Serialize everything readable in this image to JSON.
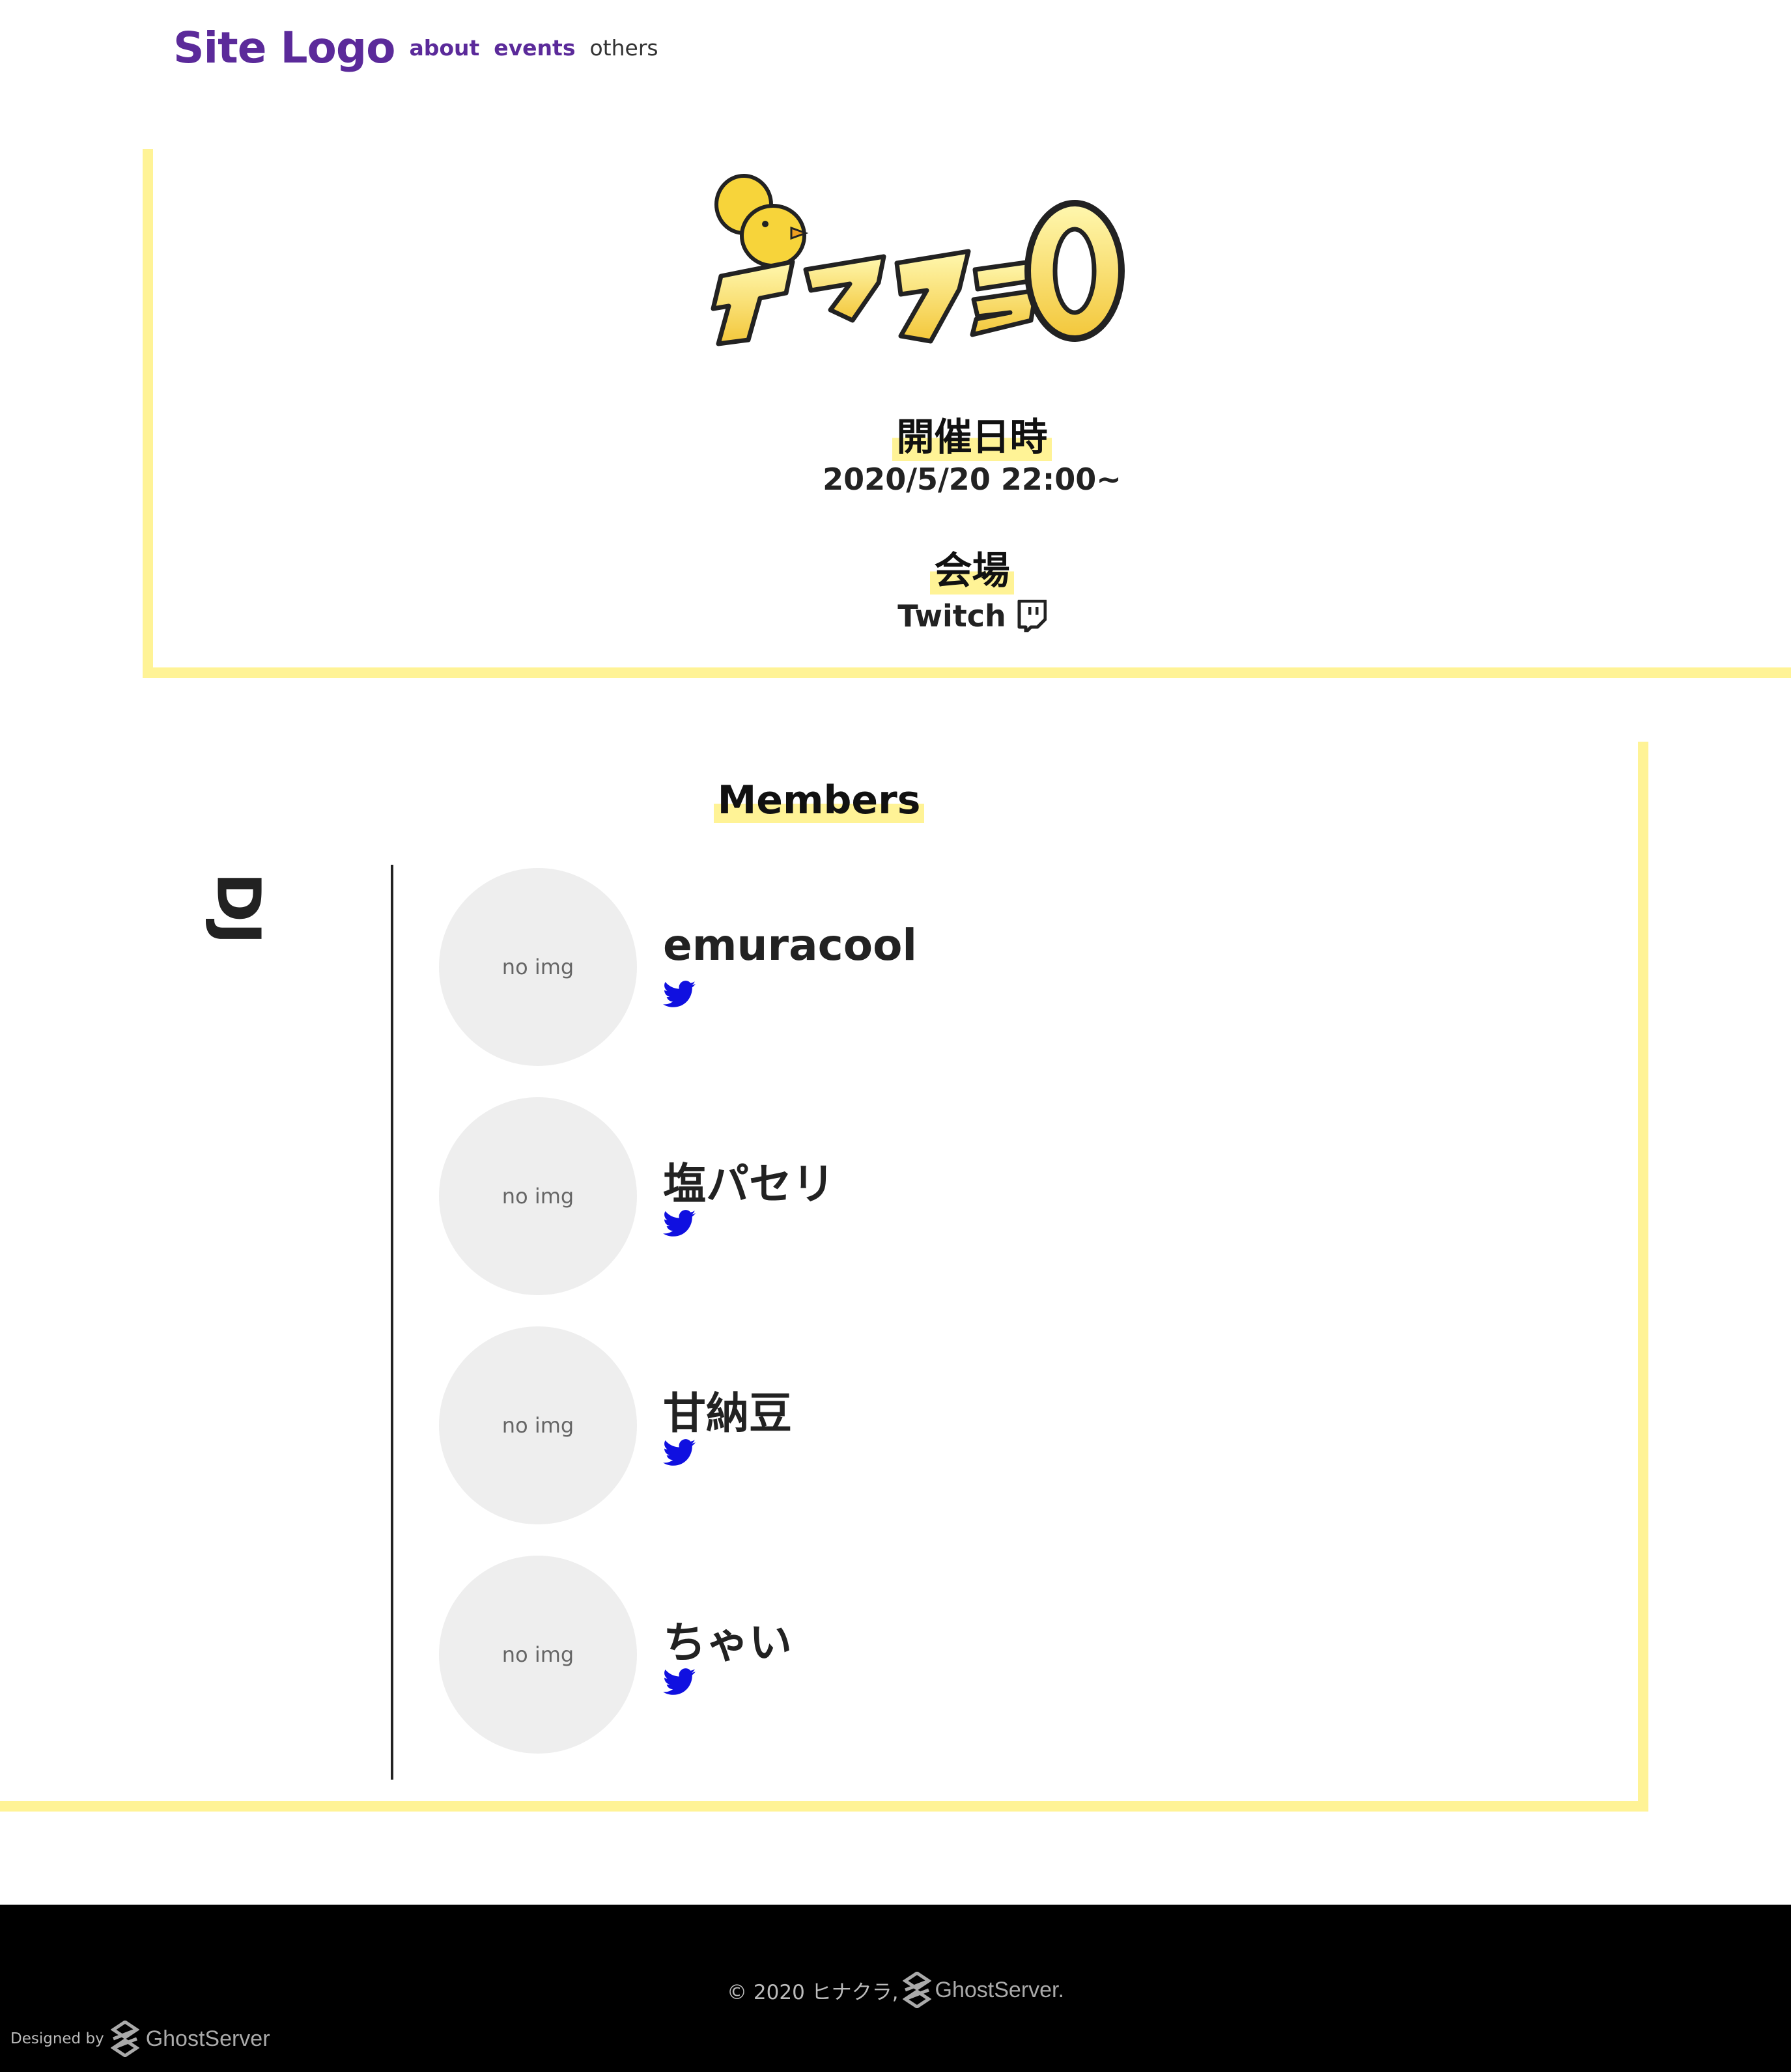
{
  "header": {
    "logo_text": "Site Logo",
    "nav": [
      {
        "label": "about"
      },
      {
        "label": "events"
      },
      {
        "label": "others"
      }
    ]
  },
  "event": {
    "logo_text": "タマクラ0",
    "datetime_label": "開催日時",
    "datetime_value": "2020/5/20 22:00~",
    "venue_label": "会場",
    "venue_value": "Twitch",
    "venue_icon": "twitch-icon"
  },
  "members_section": {
    "title": "Members",
    "role_label": "DJ",
    "members": [
      {
        "name": "emuracool",
        "avatar_placeholder": "no img",
        "social_icon": "twitter-icon"
      },
      {
        "name": "塩パセリ",
        "avatar_placeholder": "no img",
        "social_icon": "twitter-icon"
      },
      {
        "name": "甘納豆",
        "avatar_placeholder": "no img",
        "social_icon": "twitter-icon"
      },
      {
        "name": "ちゃい",
        "avatar_placeholder": "no img",
        "social_icon": "twitter-icon"
      }
    ]
  },
  "footer": {
    "copyright_text": "© 2020 ヒナクラ,",
    "copyright_brand": "GhostServer.",
    "designed_by_label": "Designed by",
    "designed_by_brand": "GhostServer"
  },
  "colors": {
    "accent_purple": "#5b2a9a",
    "highlight_yellow": "#fff396",
    "twitter_blue": "#1010e0",
    "avatar_bg": "#eeeeee",
    "footer_bg": "#000000"
  }
}
